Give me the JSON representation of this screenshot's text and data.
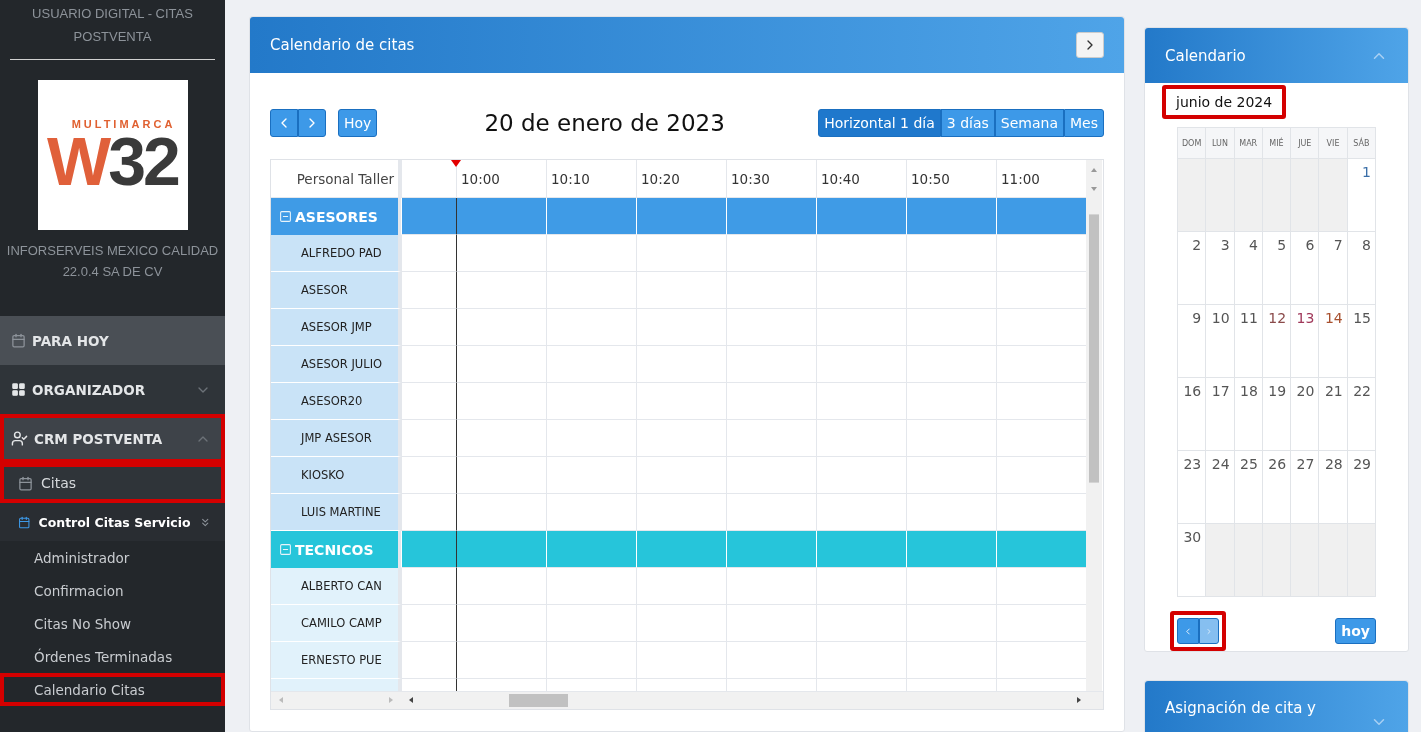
{
  "sidebar": {
    "user_title": "USUARIO DIGITAL - CITAS POSTVENTA",
    "logo": {
      "top": "MULTIMARCA",
      "mark_a": "W",
      "mark_b": "32"
    },
    "company": "INFORSERVEIS MEXICO CALIDAD 22.0.4 SA DE CV",
    "menu": [
      {
        "label": "PARA HOY",
        "kind": "section",
        "highlighted": false
      },
      {
        "label": "ORGANIZADOR",
        "kind": "section",
        "expanded": false,
        "highlighted": false
      },
      {
        "label": "CRM POSTVENTA",
        "kind": "section",
        "expanded": true,
        "highlighted": true
      },
      {
        "label": "Citas",
        "kind": "item",
        "highlighted": true
      },
      {
        "label": "Control Citas Servicio",
        "kind": "group",
        "highlighted": false
      },
      {
        "label": "Administrador",
        "kind": "sub",
        "highlighted": false
      },
      {
        "label": "Confirmacion",
        "kind": "sub",
        "highlighted": false
      },
      {
        "label": "Citas No Show",
        "kind": "sub",
        "highlighted": false
      },
      {
        "label": "Órdenes Terminadas",
        "kind": "sub",
        "highlighted": false
      },
      {
        "label": "Calendario Citas",
        "kind": "sub",
        "highlighted": true
      }
    ]
  },
  "main": {
    "title": "Calendario de citas",
    "today_button": "Hoy",
    "date_title": "20 de enero de 2023",
    "views": [
      {
        "label": "Horizontal 1 día",
        "selected": true
      },
      {
        "label": "3 días",
        "selected": false
      },
      {
        "label": "Semana",
        "selected": false
      },
      {
        "label": "Mes",
        "selected": false
      }
    ],
    "resource_header": "Personal Taller",
    "times": [
      "10:00",
      "10:10",
      "10:20",
      "10:30",
      "10:40",
      "10:50",
      "11:00"
    ],
    "groups": [
      {
        "name": "ASESORES",
        "color": "#3f9be6",
        "expanded": true,
        "resources": [
          "ALFREDO PAD",
          "ASESOR",
          "ASESOR JMP",
          "ASESOR JULIO",
          "ASESOR20",
          "JMP ASESOR",
          "KIOSKO",
          "LUIS MARTINE"
        ]
      },
      {
        "name": "TECNICOS",
        "color": "#26c5da",
        "expanded": true,
        "resources": [
          "ALBERTO CAN",
          "CAMILO CAMP",
          "ERNESTO PUE"
        ]
      }
    ]
  },
  "calendar": {
    "title": "Calendario",
    "expanded": true,
    "month": "junio de 2024",
    "month_highlighted": true,
    "weekdays": [
      "DOM",
      "LUN",
      "MAR",
      "MIÉ",
      "JUE",
      "VIE",
      "SÁB"
    ],
    "weeks": [
      [
        {
          "kind": "blank"
        },
        {
          "kind": "blank"
        },
        {
          "kind": "blank"
        },
        {
          "kind": "blank"
        },
        {
          "kind": "blank"
        },
        {
          "kind": "blank"
        },
        {
          "day": "1",
          "color": "#3b6fa8"
        }
      ],
      [
        {
          "day": "2",
          "color": "#555555"
        },
        {
          "day": "3",
          "color": "#555555"
        },
        {
          "day": "4",
          "color": "#555555"
        },
        {
          "day": "5",
          "color": "#555555"
        },
        {
          "day": "6",
          "color": "#555555"
        },
        {
          "day": "7",
          "color": "#555555"
        },
        {
          "day": "8",
          "color": "#555555"
        }
      ],
      [
        {
          "day": "9",
          "color": "#555555"
        },
        {
          "day": "10",
          "color": "#555555"
        },
        {
          "day": "11",
          "color": "#555555"
        },
        {
          "day": "12",
          "color": "#8a4a4a"
        },
        {
          "day": "13",
          "color": "#a0385a"
        },
        {
          "day": "14",
          "color": "#a8502e"
        },
        {
          "day": "15",
          "color": "#555555"
        }
      ],
      [
        {
          "day": "16",
          "color": "#555555"
        },
        {
          "day": "17",
          "color": "#555555"
        },
        {
          "day": "18",
          "color": "#555555"
        },
        {
          "day": "19",
          "color": "#555555"
        },
        {
          "day": "20",
          "color": "#555555"
        },
        {
          "day": "21",
          "color": "#555555"
        },
        {
          "day": "22",
          "color": "#555555"
        }
      ],
      [
        {
          "day": "23",
          "color": "#555555"
        },
        {
          "day": "24",
          "color": "#555555"
        },
        {
          "day": "25",
          "color": "#555555"
        },
        {
          "day": "26",
          "color": "#555555"
        },
        {
          "day": "27",
          "color": "#555555"
        },
        {
          "day": "28",
          "color": "#555555"
        },
        {
          "day": "29",
          "color": "#555555"
        }
      ],
      [
        {
          "day": "30",
          "color": "#555555"
        },
        {
          "kind": "blank"
        },
        {
          "kind": "blank"
        },
        {
          "kind": "blank"
        },
        {
          "kind": "blank"
        },
        {
          "kind": "blank"
        },
        {
          "kind": "blank"
        }
      ]
    ],
    "nav_highlighted": true,
    "today_button": "hoy"
  },
  "assign_card": {
    "title": "Asignación de cita y",
    "expanded": false
  }
}
